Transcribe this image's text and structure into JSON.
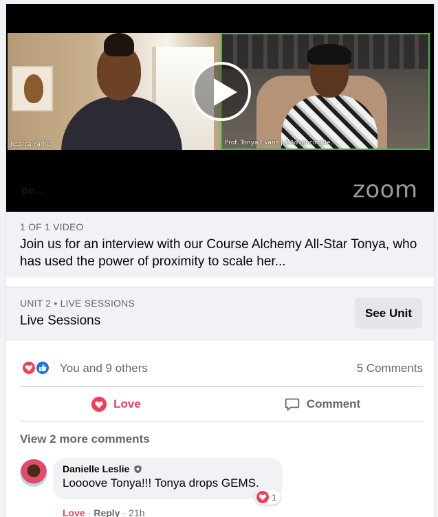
{
  "video": {
    "left_name": "Jessica Parker",
    "right_name": "Prof. Tonya Evans | #AdvancingBe...",
    "watermark_left": "Be...",
    "zoom_logo": "zoom"
  },
  "video_meta": {
    "counter": "1 OF 1 VIDEO",
    "title": "Join us for an interview with our Course Alchemy All-Star Tonya, who has used the power of proximity to scale her..."
  },
  "unit": {
    "label": "UNIT 2 • LIVE SESSIONS",
    "title": "Live Sessions",
    "button_label": "See Unit"
  },
  "reactions": {
    "summary": "You and 9 others",
    "comment_count": "5 Comments"
  },
  "actions": {
    "love_label": "Love",
    "comment_label": "Comment"
  },
  "comments": {
    "view_more": "View 2 more comments",
    "items": [
      {
        "author": "Danielle Leslie",
        "text": "Loooove Tonya!!! Tonya drops GEMS.",
        "reaction_count": "1",
        "love_label": "Love",
        "separator": "·",
        "reply_label": "Reply",
        "time": "21h"
      }
    ]
  },
  "colors": {
    "love": "#f33e58",
    "like": "#1b74e4",
    "secondary_text": "#65676b",
    "panel_bg": "#f0f2f5",
    "active_speaker_border": "#3fbf3f"
  }
}
